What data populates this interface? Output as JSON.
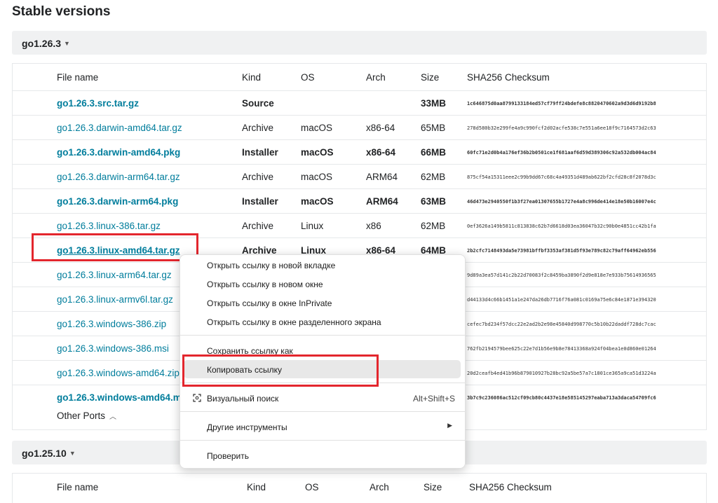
{
  "page": {
    "title": "Stable versions"
  },
  "section1": {
    "version": "go1.26.3",
    "columns": [
      "File name",
      "Kind",
      "OS",
      "Arch",
      "Size",
      "SHA256 Checksum"
    ],
    "rows": [
      {
        "file": "go1.26.3.src.tar.gz",
        "kind": "Source",
        "os": "",
        "arch": "",
        "size": "33MB",
        "sha": "1c646875d0aa8799133184ed57cf79ff24bdefe8c8820470602a9d3d6d9192b8",
        "bold": true
      },
      {
        "file": "go1.26.3.darwin-amd64.tar.gz",
        "kind": "Archive",
        "os": "macOS",
        "arch": "x86-64",
        "size": "65MB",
        "sha": "278d580b32e299fe4a9c990fcf2d02acfe538c7e551a6ee18f9c7164573d2c63",
        "bold": false
      },
      {
        "file": "go1.26.3.darwin-amd64.pkg",
        "kind": "Installer",
        "os": "macOS",
        "arch": "x86-64",
        "size": "66MB",
        "sha": "60fc71e2d0b4a176ef36b2b0501ce1f681aaf6d59d389306c92a532db004ac84",
        "bold": true
      },
      {
        "file": "go1.26.3.darwin-arm64.tar.gz",
        "kind": "Archive",
        "os": "macOS",
        "arch": "ARM64",
        "size": "62MB",
        "sha": "875cf54a15311eee2c99b9dd67c68c4a49351d489ab622bf2cfd28c8f2078d3c",
        "bold": false
      },
      {
        "file": "go1.26.3.darwin-arm64.pkg",
        "kind": "Installer",
        "os": "macOS",
        "arch": "ARM64",
        "size": "63MB",
        "sha": "46d473e2940550f1b3f27ea01307655b1727e4a8c996de414e18e50b16007e4c",
        "bold": true
      },
      {
        "file": "go1.26.3.linux-386.tar.gz",
        "kind": "Archive",
        "os": "Linux",
        "arch": "x86",
        "size": "62MB",
        "sha": "0ef3626a149b5811c813838c62b7d6618d03ea36047b32c90b0e4851cc42b1fa",
        "bold": false
      },
      {
        "file": "go1.26.3.linux-amd64.tar.gz",
        "kind": "Archive",
        "os": "Linux",
        "arch": "x86-64",
        "size": "64MB",
        "sha": "2b2cfc7148493da5e73981bffbf3353af381d5f93e789c82c79aff64962eb556",
        "bold": true
      },
      {
        "file": "go1.26.3.linux-arm64.tar.gz",
        "kind": "",
        "os": "",
        "arch": "",
        "size": "",
        "sha": "9d89a3ea57d141c2b22d70083f2c8459ba3890f2d9e818e7e933b75614936565",
        "bold": false
      },
      {
        "file": "go1.26.3.linux-armv6l.tar.gz",
        "kind": "",
        "os": "",
        "arch": "",
        "size": "",
        "sha": "d44133d4c66b1451a1e247da26db7716f76a081c0169a75e6c84e1871e394320",
        "bold": false
      },
      {
        "file": "go1.26.3.windows-386.zip",
        "kind": "",
        "os": "",
        "arch": "",
        "size": "",
        "sha": "cefec7bd234f57dcc22e2ad2b2e98e45840d998770c5b10b22daddf728dc7cac",
        "bold": false
      },
      {
        "file": "go1.26.3.windows-386.msi",
        "kind": "",
        "os": "",
        "arch": "",
        "size": "",
        "sha": "762fb2194579bee625c22e7d1b56e9b8e78413368a924f04bea1e0d860e01264",
        "bold": false
      },
      {
        "file": "go1.26.3.windows-amd64.zip",
        "kind": "",
        "os": "",
        "arch": "",
        "size": "",
        "sha": "20d2ceafb4ed41b96b879010927b28bc92a5be57a7c1801ce365a9ca51d3224a",
        "bold": false
      },
      {
        "file": "go1.26.3.windows-amd64.m",
        "kind": "",
        "os": "",
        "arch": "",
        "size": "",
        "sha": "3b7c9c236086ac512cf09cb80c4437e18e585145297eaba713a3daca54709fc6",
        "bold": true
      }
    ],
    "other_ports": "Other Ports"
  },
  "section2": {
    "version": "go1.25.10",
    "columns": [
      "File name",
      "Kind",
      "OS",
      "Arch",
      "Size",
      "SHA256 Checksum"
    ]
  },
  "context_menu": {
    "items": [
      {
        "label": "Открыть ссылку в новой вкладке"
      },
      {
        "label": "Открыть ссылку в новом окне"
      },
      {
        "label": "Открыть ссылку в окне InPrivate"
      },
      {
        "label": "Открыть ссылку в окне разделенного экрана"
      },
      {
        "label": "Сохранить ссылку как"
      },
      {
        "label": "Копировать ссылку"
      },
      {
        "label": "Визуальный поиск",
        "shortcut": "Alt+Shift+S"
      },
      {
        "label": "Другие инструменты"
      },
      {
        "label": "Проверить"
      }
    ]
  }
}
